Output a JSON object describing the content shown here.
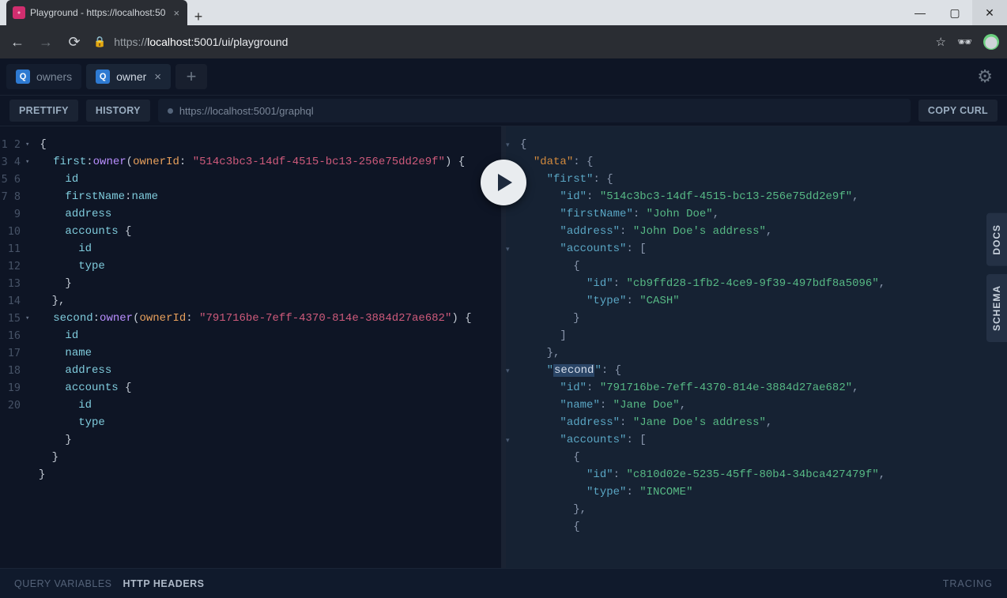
{
  "browser": {
    "tab_title": "Playground - https://localhost:50",
    "url_display_proto": "https://",
    "url_display_host": "localhost",
    "url_display_port_path": ":5001/ui/playground"
  },
  "app": {
    "tabs": [
      {
        "icon": "Q",
        "label": "owners"
      },
      {
        "icon": "Q",
        "label": "owner"
      }
    ],
    "toolbar": {
      "prettify": "PRETTIFY",
      "history": "HISTORY",
      "endpoint": "https://localhost:5001/graphql",
      "copy_curl": "COPY CURL"
    },
    "side": {
      "docs": "DOCS",
      "schema": "SCHEMA"
    },
    "footer": {
      "qv": "QUERY VARIABLES",
      "hh": "HTTP HEADERS",
      "tracing": "TRACING"
    }
  },
  "query_lines": 20,
  "query": {
    "alias1": "first",
    "alias2": "second",
    "type": "owner",
    "arg": "ownerId",
    "id1": "514c3bc3-14df-4515-bc13-256e75dd2e9f",
    "id2": "791716be-7eff-4370-814e-3884d27ae682",
    "f_id": "id",
    "f_firstName": "firstName",
    "f_nameAlias": "name",
    "f_name": "name",
    "f_address": "address",
    "f_accounts": "accounts",
    "f_type": "type"
  },
  "result": {
    "data_key": "data",
    "first_key": "first",
    "second_key": "second",
    "id_key": "id",
    "firstName_key": "firstName",
    "name_key": "name",
    "address_key": "address",
    "accounts_key": "accounts",
    "type_key": "type",
    "first": {
      "id": "514c3bc3-14df-4515-bc13-256e75dd2e9f",
      "firstName": "John Doe",
      "address": "John Doe's address",
      "account_id": "cb9ffd28-1fb2-4ce9-9f39-497bdf8a5096",
      "account_type": "CASH"
    },
    "second": {
      "id": "791716be-7eff-4370-814e-3884d27ae682",
      "name": "Jane Doe",
      "address": "Jane Doe's address",
      "acc1_id": "c810d02e-5235-45ff-80b4-34bca427479f",
      "acc1_type": "INCOME"
    }
  }
}
